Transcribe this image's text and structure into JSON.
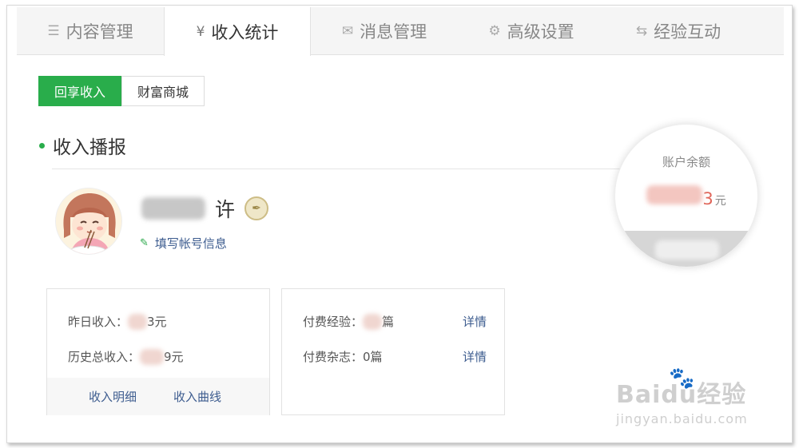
{
  "tabs": [
    {
      "label": "内容管理",
      "icon": "list-icon",
      "glyph": "☰"
    },
    {
      "label": "收入统计",
      "icon": "yen-icon",
      "glyph": "¥"
    },
    {
      "label": "消息管理",
      "icon": "mail-icon",
      "glyph": "✉"
    },
    {
      "label": "高级设置",
      "icon": "gear-icon",
      "glyph": "⚙"
    },
    {
      "label": "经验互动",
      "icon": "exchange-icon",
      "glyph": "⇆"
    }
  ],
  "active_tab": "收入统计",
  "subtabs": [
    "回享收入",
    "财富商城"
  ],
  "active_subtab": "回享收入",
  "section": {
    "title": "收入播报"
  },
  "profile": {
    "name_visible": "许",
    "badge_icon": "pen-badge-icon",
    "fill_info_label": "填写帐号信息"
  },
  "balance": {
    "label": "账户余额",
    "amount_visible": "3",
    "unit": "元"
  },
  "income_card": {
    "yesterday_label": "昨日收入：",
    "yesterday_tail": "3元",
    "total_label": "历史总收入：",
    "total_tail": "9元",
    "link_detail": "收入明细",
    "link_curve": "收入曲线"
  },
  "paid_card": {
    "experience_label": "付费经验：",
    "experience_tail": "篇",
    "magazine_text": "付费杂志：0篇",
    "detail_label": "详情"
  },
  "watermark": {
    "brand": "Baidu经验",
    "url": "jingyan.baidu.com"
  },
  "colors": {
    "accent_green": "#29ad4b",
    "link_blue": "#3d5c8f",
    "amount_red": "#e0665a"
  }
}
